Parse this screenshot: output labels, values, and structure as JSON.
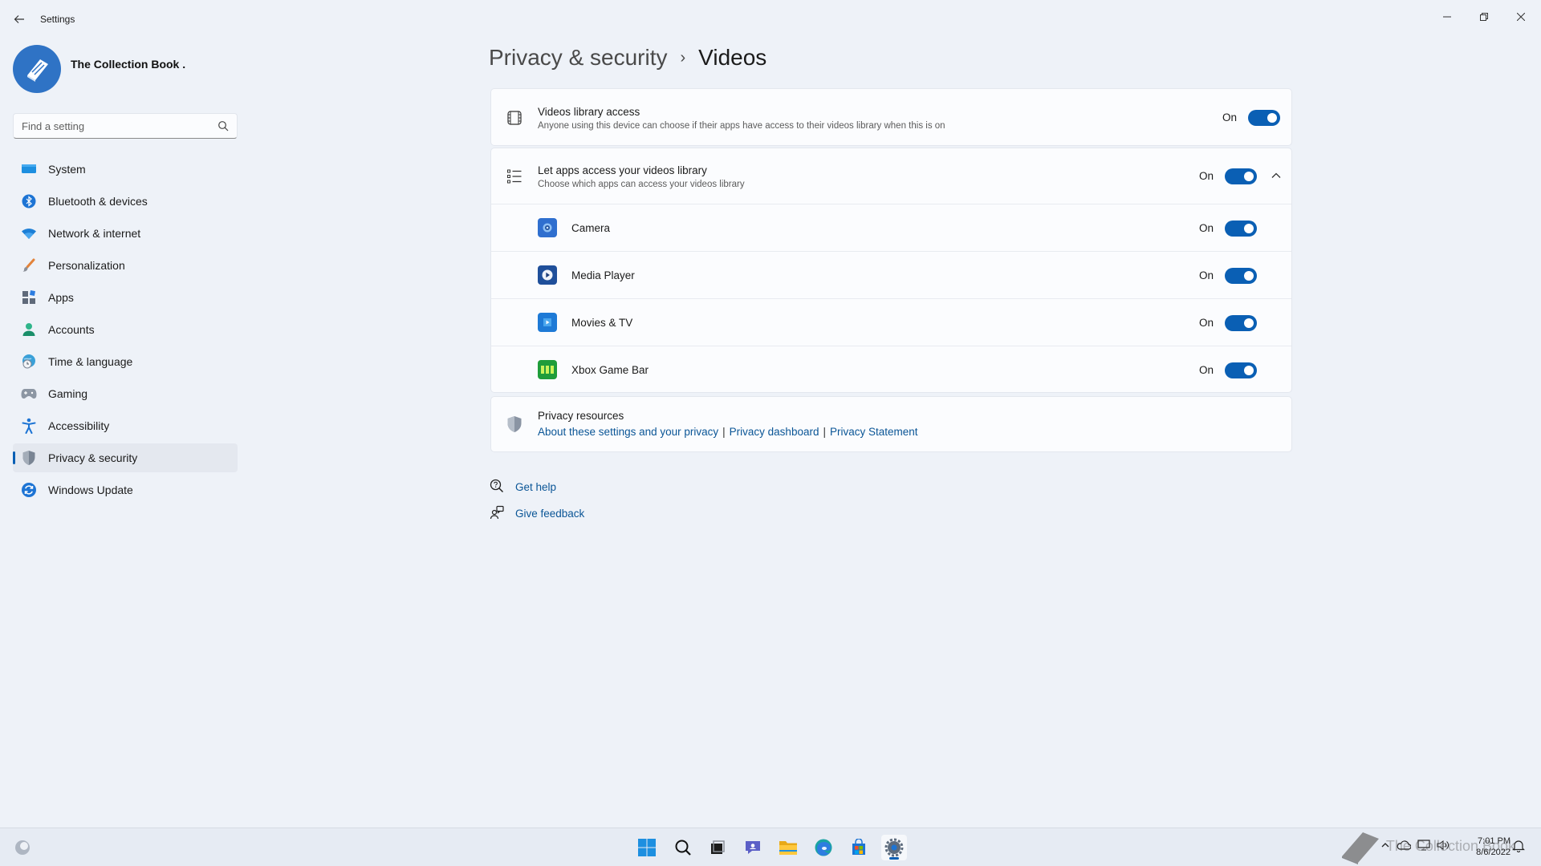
{
  "window": {
    "title": "Settings",
    "back_icon": "back-arrow-icon",
    "controls": [
      "minimize-icon",
      "restore-icon",
      "close-icon"
    ]
  },
  "profile": {
    "name": "The Collection Book ."
  },
  "search": {
    "placeholder": "Find a setting",
    "value": ""
  },
  "nav": {
    "items": [
      {
        "label": "System",
        "icon": "monitor-icon"
      },
      {
        "label": "Bluetooth & devices",
        "icon": "bluetooth-icon"
      },
      {
        "label": "Network & internet",
        "icon": "wifi-icon"
      },
      {
        "label": "Personalization",
        "icon": "brush-icon"
      },
      {
        "label": "Apps",
        "icon": "apps-icon"
      },
      {
        "label": "Accounts",
        "icon": "person-icon"
      },
      {
        "label": "Time & language",
        "icon": "globe-clock-icon"
      },
      {
        "label": "Gaming",
        "icon": "controller-icon"
      },
      {
        "label": "Accessibility",
        "icon": "accessibility-icon"
      },
      {
        "label": "Privacy & security",
        "icon": "shield-icon",
        "active": true
      },
      {
        "label": "Windows Update",
        "icon": "update-icon"
      }
    ]
  },
  "header": {
    "parent": "Privacy & security",
    "separator": "›",
    "current": "Videos"
  },
  "library_access": {
    "title": "Videos library access",
    "description": "Anyone using this device can choose if their apps have access to their videos library when this is on",
    "state_label": "On",
    "enabled": true
  },
  "apps_access": {
    "title": "Let apps access your videos library",
    "description": "Choose which apps can access your videos library",
    "state_label": "On",
    "enabled": true,
    "expanded": true,
    "apps": [
      {
        "name": "Camera",
        "state_label": "On",
        "enabled": true,
        "icon": "camera-app-icon",
        "color": "#2f6fcf"
      },
      {
        "name": "Media Player",
        "state_label": "On",
        "enabled": true,
        "icon": "media-player-icon",
        "color": "#1f4f9a"
      },
      {
        "name": "Movies & TV",
        "state_label": "On",
        "enabled": true,
        "icon": "movies-tv-icon",
        "color": "#1e7ad6"
      },
      {
        "name": "Xbox Game Bar",
        "state_label": "On",
        "enabled": true,
        "icon": "xbox-game-bar-icon",
        "color": "#1f9d3a"
      }
    ]
  },
  "privacy_resources": {
    "title": "Privacy resources",
    "links": [
      "About these settings and your privacy",
      "Privacy dashboard",
      "Privacy Statement"
    ],
    "separator": "|"
  },
  "help": {
    "get_help": "Get help",
    "give_feedback": "Give feedback"
  },
  "taskbar": {
    "apps": [
      "start-icon",
      "search-icon",
      "task-view-icon",
      "chat-icon",
      "file-explorer-icon",
      "edge-icon",
      "store-icon",
      "settings-icon"
    ],
    "active_app": "settings-icon",
    "time": "7:01 PM",
    "date": "8/6/2022",
    "watermark": "The Collection Book"
  },
  "colors": {
    "accent": "#0a5fb4",
    "background": "#eef2f8",
    "card": "#fbfcfe",
    "link": "#0a5596"
  }
}
